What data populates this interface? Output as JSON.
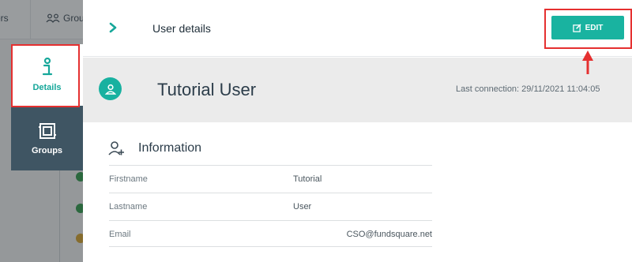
{
  "background": {
    "tab_users_label": "ers",
    "tab_groups_label": "Grou"
  },
  "side_tabs": {
    "items": [
      {
        "label": "Details",
        "icon": "info-icon",
        "active": true
      },
      {
        "label": "Groups",
        "icon": "groups-icon",
        "active": false
      }
    ]
  },
  "panel": {
    "title": "User details",
    "edit_label": "EDIT",
    "user_name": "Tutorial User",
    "last_connection": "Last connection: 29/11/2021 11:04:05",
    "information_title": "Information",
    "fields": [
      {
        "label": "Firstname",
        "value": "Tutorial"
      },
      {
        "label": "Lastname",
        "value": "User"
      },
      {
        "label": "Email",
        "value": "CSO@fundsquare.net"
      }
    ]
  },
  "colors": {
    "accent": "#19b3a0",
    "annotation": "#e53030",
    "side_tabs_bg": "#3f5563"
  }
}
